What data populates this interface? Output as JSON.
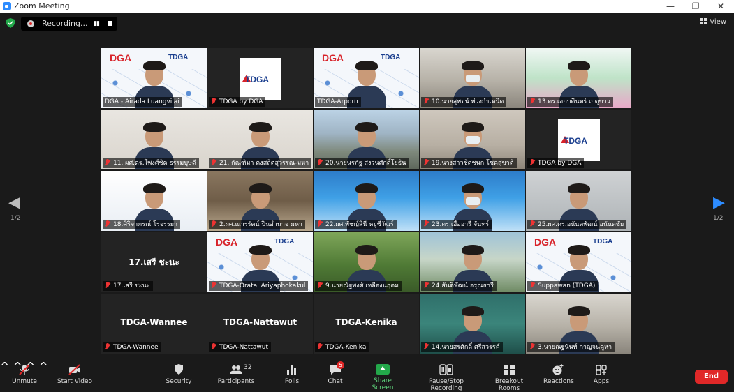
{
  "window": {
    "title": "Zoom Meeting",
    "minimize": "—",
    "restore": "❐",
    "close": "✕"
  },
  "recording": {
    "label": "Recording...",
    "pause_icon": "pause-icon",
    "stop_icon": "stop-icon"
  },
  "view_button": {
    "label": "View"
  },
  "pagination": {
    "left_page": "1/2",
    "right_page": "1/2"
  },
  "participants": [
    {
      "name": "DGA - Airada Luangvilai",
      "muted": false,
      "active": true,
      "kind": "person-slide"
    },
    {
      "name": "TDGA  by DGA",
      "muted": true,
      "kind": "tdga-logo"
    },
    {
      "name": "TDGA-Arporn",
      "muted": false,
      "kind": "person-slide"
    },
    {
      "name": "10.นายสุพจน์ พ่วงกำเหนิด",
      "muted": true,
      "kind": "person-room",
      "mask": true
    },
    {
      "name": "13.ดร.เอกบดินทร์ เกตุขาว",
      "muted": true,
      "kind": "person-lotus"
    },
    {
      "name": "11. ผศ.ดร.โพงศ์ชิต ธรรมบุษดี",
      "muted": true,
      "kind": "person-wall"
    },
    {
      "name": "21. กัณฑิมา คงสถิตสุวรรณ-มหา",
      "muted": true,
      "kind": "person-wall"
    },
    {
      "name": "20.นายนรภัฐ สงวนศักดิ์โยธิน",
      "muted": true,
      "kind": "person-city"
    },
    {
      "name": "19.นางสาวชิดชนก โชคสุขาติ",
      "muted": true,
      "kind": "person-office",
      "mask": true
    },
    {
      "name": "TDGA  by DGA",
      "muted": true,
      "kind": "tdga-logo-dark"
    },
    {
      "name": "18.ศิริจาภรณ์ โรจรรยา",
      "muted": true,
      "kind": "person-cartoon"
    },
    {
      "name": "2.ผศ.ณารรัตน์ ปิ่นอำนาจ มหา",
      "muted": true,
      "kind": "person-shelf"
    },
    {
      "name": "22.ผศ.พัชญ์สินี หยูชีวัฒร์",
      "muted": true,
      "kind": "person-uni"
    },
    {
      "name": "23.ดร.เอื้ออารี จันทร์",
      "muted": true,
      "kind": "person-uni",
      "mask": true
    },
    {
      "name": "25.ผศ.ดร.อนันตพัฒน์ อนันตชัย",
      "muted": true,
      "kind": "person-gray"
    },
    {
      "name": "17.เสรี ชะนะ",
      "muted": true,
      "kind": "name-only",
      "big_name": "17.เสรี ชะนะ"
    },
    {
      "name": "TDGA-Oratai Ariyaphokakul",
      "muted": true,
      "kind": "person-slide"
    },
    {
      "name": "9.นายณัฐพงศ์ เหลืองนฤตม",
      "muted": true,
      "kind": "person-garden"
    },
    {
      "name": "24.สันติพัฒน์ อรุณธารี",
      "muted": true,
      "kind": "person-mount"
    },
    {
      "name": "Suppawan (TDGA)",
      "muted": true,
      "kind": "person-slide"
    },
    {
      "name": "TDGA-Wannee",
      "muted": true,
      "kind": "name-only",
      "big_name": "TDGA-Wannee"
    },
    {
      "name": "TDGA-Nattawut",
      "muted": true,
      "kind": "name-only",
      "big_name": "TDGA-Nattawut"
    },
    {
      "name": "TDGA-Kenika",
      "muted": true,
      "kind": "name-only",
      "big_name": "TDGA-Kenika"
    },
    {
      "name": "14.นายสรศักดิ์ ศรีสวรรค์",
      "muted": true,
      "kind": "person-teal"
    },
    {
      "name": "3.นายณฐนันท์ กาญจนคูหา",
      "muted": true,
      "kind": "person-room"
    }
  ],
  "toolbar": {
    "unmute": "Unmute",
    "start_video": "Start Video",
    "security": "Security",
    "participants": "Participants",
    "participants_count": "32",
    "polls": "Polls",
    "chat": "Chat",
    "chat_badge": "5",
    "share_screen": "Share Screen",
    "pause_stop_recording": "Pause/Stop Recording",
    "breakout_rooms": "Breakout Rooms",
    "reactions": "Reactions",
    "apps": "Apps",
    "end": "End"
  },
  "colors": {
    "accent": "#2d8cff",
    "active_speaker": "#c4e56b",
    "end_button": "#e02828",
    "share_green": "#23a84a"
  }
}
